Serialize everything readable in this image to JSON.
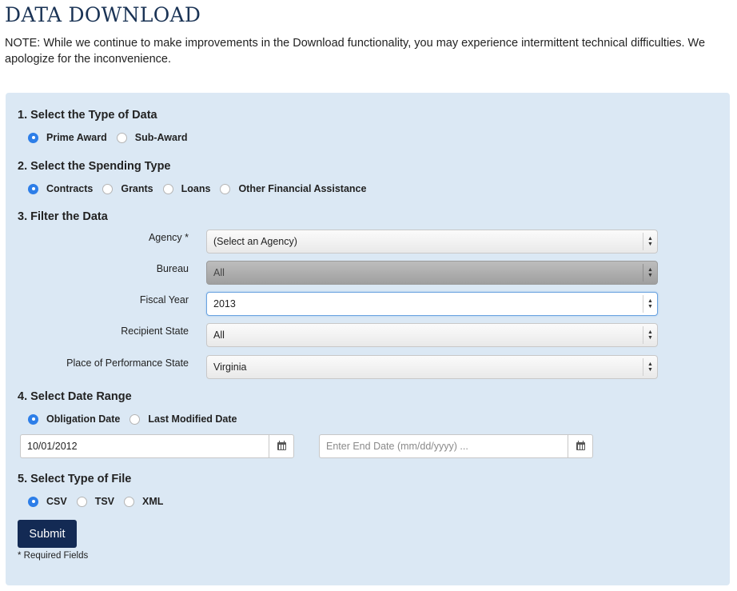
{
  "page": {
    "title": "DATA DOWNLOAD",
    "note": "NOTE: While we continue to make improvements in the Download functionality, you may experience intermittent technical difficulties. We apologize for the inconvenience."
  },
  "data_type": {
    "title": "1. Select the Type of Data",
    "options": [
      {
        "label": "Prime Award",
        "checked": true
      },
      {
        "label": "Sub-Award",
        "checked": false
      }
    ]
  },
  "spending_type": {
    "title": "2. Select the Spending Type",
    "options": [
      {
        "label": "Contracts",
        "checked": true
      },
      {
        "label": "Grants",
        "checked": false
      },
      {
        "label": "Loans",
        "checked": false
      },
      {
        "label": "Other Financial Assistance",
        "checked": false
      }
    ]
  },
  "filter": {
    "title": "3. Filter the Data",
    "fields": [
      {
        "label": "Agency *",
        "value": "(Select an Agency)"
      },
      {
        "label": "Bureau",
        "value": "All"
      },
      {
        "label": "Fiscal Year",
        "value": "2013"
      },
      {
        "label": "Recipient State",
        "value": "All"
      },
      {
        "label": "Place of Performance State",
        "value": "Virginia"
      }
    ]
  },
  "date_range": {
    "title": "4. Select Date Range",
    "options": [
      {
        "label": "Obligation Date",
        "checked": true
      },
      {
        "label": "Last Modified Date",
        "checked": false
      }
    ],
    "start_value": "10/01/2012",
    "end_value": "",
    "end_placeholder": "Enter End Date (mm/dd/yyyy) ...",
    "icon": "calendar-icon"
  },
  "file_type": {
    "title": "5. Select Type of File",
    "options": [
      {
        "label": "CSV",
        "checked": true
      },
      {
        "label": "TSV",
        "checked": false
      },
      {
        "label": "XML",
        "checked": false
      }
    ]
  },
  "submit_label": "Submit",
  "required_note": "* Required Fields",
  "colors": {
    "panel_bg": "#dbe8f4",
    "title": "#1a3355",
    "submit_bg": "#132a54",
    "radio_checked": "#2d7ee8"
  }
}
